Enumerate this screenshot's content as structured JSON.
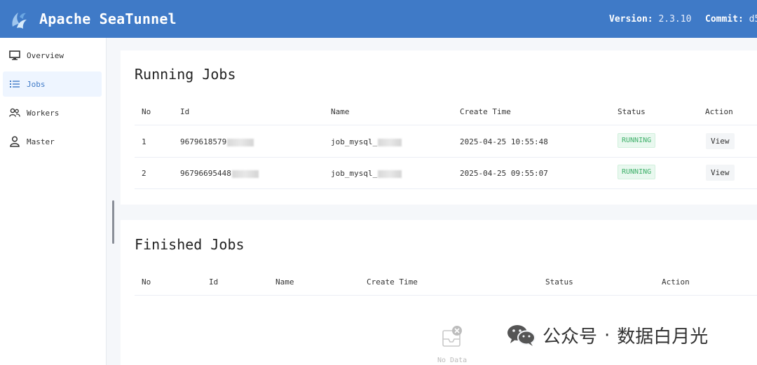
{
  "header": {
    "title": "Apache SeaTunnel",
    "version_label": "Version:",
    "version_value": "2.3.10",
    "commit_label": "Commit:",
    "commit_value": "d5"
  },
  "sidebar": {
    "items": [
      {
        "label": "Overview",
        "icon": "monitor-icon"
      },
      {
        "label": "Jobs",
        "icon": "list-icon",
        "active": true
      },
      {
        "label": "Workers",
        "icon": "users-icon"
      },
      {
        "label": "Master",
        "icon": "user-icon"
      }
    ]
  },
  "running": {
    "title": "Running Jobs",
    "columns": [
      "No",
      "Id",
      "Name",
      "Create Time",
      "Status",
      "Action"
    ],
    "rows": [
      {
        "no": "1",
        "id": "9679618579",
        "name": "job_mysql_",
        "create_time": "2025-04-25 10:55:48",
        "status": "RUNNING",
        "action": "View"
      },
      {
        "no": "2",
        "id": "96796695448",
        "name": "job_mysql_",
        "create_time": "2025-04-25 09:55:07",
        "status": "RUNNING",
        "action": "View"
      }
    ]
  },
  "finished": {
    "title": "Finished Jobs",
    "columns": [
      "No",
      "Id",
      "Name",
      "Create Time",
      "Status",
      "Action"
    ],
    "empty_text": "No Data"
  },
  "watermark": {
    "text": "公众号",
    "separator": "·",
    "name": "数据白月光"
  },
  "colors": {
    "header_bg": "#3f7ac7",
    "accent": "#3f7ac7",
    "status_running": "#3fb06a"
  }
}
